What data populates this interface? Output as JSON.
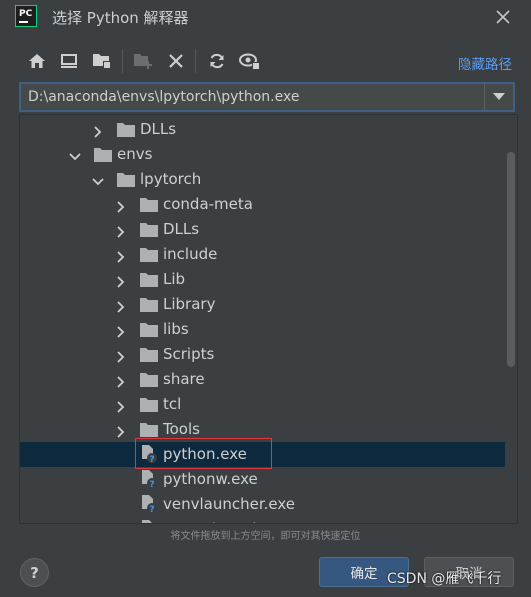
{
  "window": {
    "title": "选择 Python 解释器",
    "app_logo_text": "PC"
  },
  "toolbar": {
    "buttons": [
      {
        "name": "home-icon"
      },
      {
        "name": "desktop-icon"
      },
      {
        "name": "project-folder-icon"
      },
      {
        "name": "new-folder-icon",
        "disabled": true
      },
      {
        "name": "delete-icon"
      },
      {
        "name": "refresh-icon"
      },
      {
        "name": "show-hidden-icon"
      }
    ],
    "hide_path_label": "隐藏路径"
  },
  "path": {
    "value": "D:\\anaconda\\envs\\lpytorch\\python.exe"
  },
  "tree": {
    "rows": [
      {
        "label": "DLLs",
        "depth": 2,
        "type": "folder",
        "expanded": false
      },
      {
        "label": "envs",
        "depth": 1,
        "type": "folder",
        "expanded": true
      },
      {
        "label": "lpytorch",
        "depth": 2,
        "type": "folder",
        "expanded": true
      },
      {
        "label": "conda-meta",
        "depth": 3,
        "type": "folder",
        "expanded": false
      },
      {
        "label": "DLLs",
        "depth": 3,
        "type": "folder",
        "expanded": false
      },
      {
        "label": "include",
        "depth": 3,
        "type": "folder",
        "expanded": false
      },
      {
        "label": "Lib",
        "depth": 3,
        "type": "folder",
        "expanded": false
      },
      {
        "label": "Library",
        "depth": 3,
        "type": "folder",
        "expanded": false
      },
      {
        "label": "libs",
        "depth": 3,
        "type": "folder",
        "expanded": false
      },
      {
        "label": "Scripts",
        "depth": 3,
        "type": "folder",
        "expanded": false
      },
      {
        "label": "share",
        "depth": 3,
        "type": "folder",
        "expanded": false
      },
      {
        "label": "tcl",
        "depth": 3,
        "type": "folder",
        "expanded": false
      },
      {
        "label": "Tools",
        "depth": 3,
        "type": "folder",
        "expanded": false
      },
      {
        "label": "python.exe",
        "depth": 3,
        "type": "file",
        "selected": true
      },
      {
        "label": "pythonw.exe",
        "depth": 3,
        "type": "file"
      },
      {
        "label": "venvlauncher.exe",
        "depth": 3,
        "type": "file"
      },
      {
        "label": "venvwlauncher.exe",
        "depth": 3,
        "type": "file"
      }
    ]
  },
  "hint": "将文件拖放到上方空间，即可对其快速定位",
  "buttons": {
    "help": "?",
    "ok": "确定",
    "cancel": "取消"
  },
  "watermark": "CSDN @雁飞千行"
}
